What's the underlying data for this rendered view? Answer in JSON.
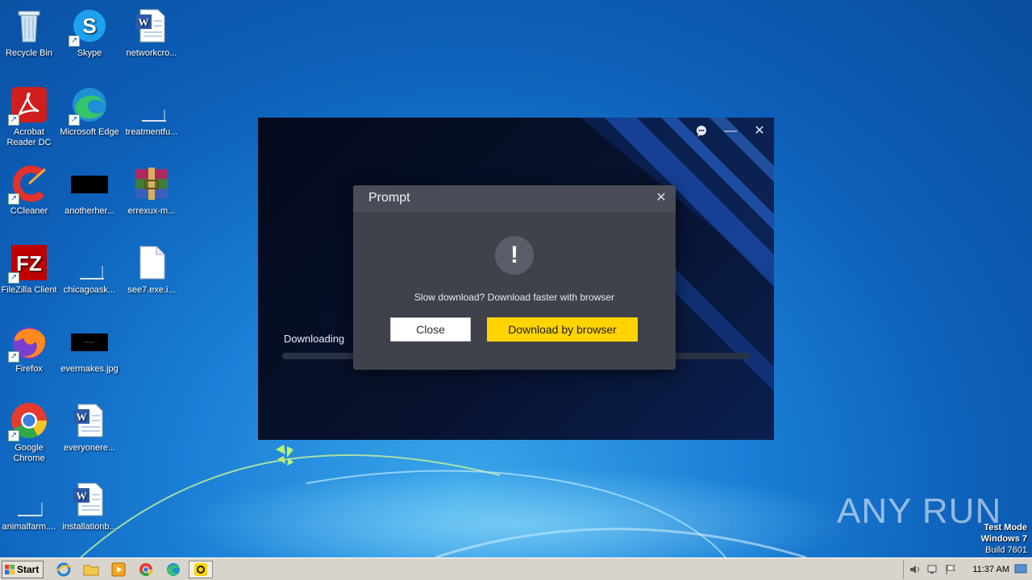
{
  "desktop": {
    "icons": [
      {
        "label": "Recycle Bin"
      },
      {
        "label": "Skype"
      },
      {
        "label": "networkcro..."
      },
      {
        "label": "Acrobat Reader DC"
      },
      {
        "label": "Microsoft Edge"
      },
      {
        "label": "treatmentfu..."
      },
      {
        "label": "CCleaner"
      },
      {
        "label": "anotherher..."
      },
      {
        "label": "errexux-m..."
      },
      {
        "label": "FileZilla Client"
      },
      {
        "label": "chicagoask..."
      },
      {
        "label": "see7.exe.i..."
      },
      {
        "label": "Firefox"
      },
      {
        "label": "evermakes.jpg"
      },
      {
        "label": "Google Chrome"
      },
      {
        "label": "everyonere..."
      },
      {
        "label": "animalfarm...."
      },
      {
        "label": "installationb..."
      }
    ]
  },
  "launcher": {
    "download_label": "Downloading",
    "progress_fraction": 0.0
  },
  "prompt": {
    "title": "Prompt",
    "message": "Slow download? Download faster with browser",
    "close_label": "Close",
    "browser_label": "Download by browser",
    "warning_glyph": "!"
  },
  "watermark": {
    "text": "ANY RUN"
  },
  "os_info": {
    "line1": "Test Mode",
    "line2": "Windows 7",
    "line3": "Build 7601"
  },
  "taskbar": {
    "start_label": "Start",
    "clock": "11:37 AM"
  },
  "colors": {
    "accent_button": "#ffd400",
    "dialog_bg": "#3f424b"
  }
}
